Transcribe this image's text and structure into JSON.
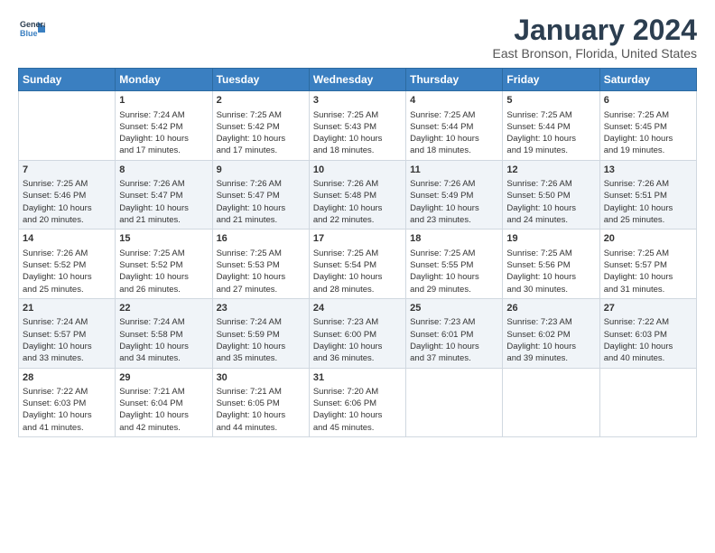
{
  "header": {
    "logo_line1": "General",
    "logo_line2": "Blue",
    "month": "January 2024",
    "location": "East Bronson, Florida, United States"
  },
  "days_of_week": [
    "Sunday",
    "Monday",
    "Tuesday",
    "Wednesday",
    "Thursday",
    "Friday",
    "Saturday"
  ],
  "weeks": [
    [
      {
        "num": "",
        "info": ""
      },
      {
        "num": "1",
        "info": "Sunrise: 7:24 AM\nSunset: 5:42 PM\nDaylight: 10 hours\nand 17 minutes."
      },
      {
        "num": "2",
        "info": "Sunrise: 7:25 AM\nSunset: 5:42 PM\nDaylight: 10 hours\nand 17 minutes."
      },
      {
        "num": "3",
        "info": "Sunrise: 7:25 AM\nSunset: 5:43 PM\nDaylight: 10 hours\nand 18 minutes."
      },
      {
        "num": "4",
        "info": "Sunrise: 7:25 AM\nSunset: 5:44 PM\nDaylight: 10 hours\nand 18 minutes."
      },
      {
        "num": "5",
        "info": "Sunrise: 7:25 AM\nSunset: 5:44 PM\nDaylight: 10 hours\nand 19 minutes."
      },
      {
        "num": "6",
        "info": "Sunrise: 7:25 AM\nSunset: 5:45 PM\nDaylight: 10 hours\nand 19 minutes."
      }
    ],
    [
      {
        "num": "7",
        "info": "Sunrise: 7:25 AM\nSunset: 5:46 PM\nDaylight: 10 hours\nand 20 minutes."
      },
      {
        "num": "8",
        "info": "Sunrise: 7:26 AM\nSunset: 5:47 PM\nDaylight: 10 hours\nand 21 minutes."
      },
      {
        "num": "9",
        "info": "Sunrise: 7:26 AM\nSunset: 5:47 PM\nDaylight: 10 hours\nand 21 minutes."
      },
      {
        "num": "10",
        "info": "Sunrise: 7:26 AM\nSunset: 5:48 PM\nDaylight: 10 hours\nand 22 minutes."
      },
      {
        "num": "11",
        "info": "Sunrise: 7:26 AM\nSunset: 5:49 PM\nDaylight: 10 hours\nand 23 minutes."
      },
      {
        "num": "12",
        "info": "Sunrise: 7:26 AM\nSunset: 5:50 PM\nDaylight: 10 hours\nand 24 minutes."
      },
      {
        "num": "13",
        "info": "Sunrise: 7:26 AM\nSunset: 5:51 PM\nDaylight: 10 hours\nand 25 minutes."
      }
    ],
    [
      {
        "num": "14",
        "info": "Sunrise: 7:26 AM\nSunset: 5:52 PM\nDaylight: 10 hours\nand 25 minutes."
      },
      {
        "num": "15",
        "info": "Sunrise: 7:25 AM\nSunset: 5:52 PM\nDaylight: 10 hours\nand 26 minutes."
      },
      {
        "num": "16",
        "info": "Sunrise: 7:25 AM\nSunset: 5:53 PM\nDaylight: 10 hours\nand 27 minutes."
      },
      {
        "num": "17",
        "info": "Sunrise: 7:25 AM\nSunset: 5:54 PM\nDaylight: 10 hours\nand 28 minutes."
      },
      {
        "num": "18",
        "info": "Sunrise: 7:25 AM\nSunset: 5:55 PM\nDaylight: 10 hours\nand 29 minutes."
      },
      {
        "num": "19",
        "info": "Sunrise: 7:25 AM\nSunset: 5:56 PM\nDaylight: 10 hours\nand 30 minutes."
      },
      {
        "num": "20",
        "info": "Sunrise: 7:25 AM\nSunset: 5:57 PM\nDaylight: 10 hours\nand 31 minutes."
      }
    ],
    [
      {
        "num": "21",
        "info": "Sunrise: 7:24 AM\nSunset: 5:57 PM\nDaylight: 10 hours\nand 33 minutes."
      },
      {
        "num": "22",
        "info": "Sunrise: 7:24 AM\nSunset: 5:58 PM\nDaylight: 10 hours\nand 34 minutes."
      },
      {
        "num": "23",
        "info": "Sunrise: 7:24 AM\nSunset: 5:59 PM\nDaylight: 10 hours\nand 35 minutes."
      },
      {
        "num": "24",
        "info": "Sunrise: 7:23 AM\nSunset: 6:00 PM\nDaylight: 10 hours\nand 36 minutes."
      },
      {
        "num": "25",
        "info": "Sunrise: 7:23 AM\nSunset: 6:01 PM\nDaylight: 10 hours\nand 37 minutes."
      },
      {
        "num": "26",
        "info": "Sunrise: 7:23 AM\nSunset: 6:02 PM\nDaylight: 10 hours\nand 39 minutes."
      },
      {
        "num": "27",
        "info": "Sunrise: 7:22 AM\nSunset: 6:03 PM\nDaylight: 10 hours\nand 40 minutes."
      }
    ],
    [
      {
        "num": "28",
        "info": "Sunrise: 7:22 AM\nSunset: 6:03 PM\nDaylight: 10 hours\nand 41 minutes."
      },
      {
        "num": "29",
        "info": "Sunrise: 7:21 AM\nSunset: 6:04 PM\nDaylight: 10 hours\nand 42 minutes."
      },
      {
        "num": "30",
        "info": "Sunrise: 7:21 AM\nSunset: 6:05 PM\nDaylight: 10 hours\nand 44 minutes."
      },
      {
        "num": "31",
        "info": "Sunrise: 7:20 AM\nSunset: 6:06 PM\nDaylight: 10 hours\nand 45 minutes."
      },
      {
        "num": "",
        "info": ""
      },
      {
        "num": "",
        "info": ""
      },
      {
        "num": "",
        "info": ""
      }
    ]
  ]
}
